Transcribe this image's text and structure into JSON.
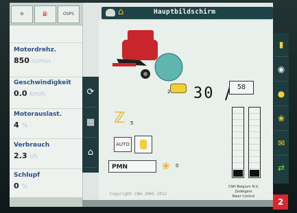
{
  "header": {
    "title": "Hauptbildschirm"
  },
  "sidebar": {
    "top_icon_caption": "OSPS",
    "metrics": [
      {
        "label": "Motordrehz.",
        "value": "850",
        "unit": "U/min"
      },
      {
        "label": "Geschwindigkeit",
        "value": "0.0",
        "unit": "km/h"
      },
      {
        "label": "Motorauslast.",
        "value": "4",
        "unit": "%"
      },
      {
        "label": "Verbrauch",
        "value": "2.3",
        "unit": "l/h"
      },
      {
        "label": "Schlupf",
        "value": "0",
        "unit": "%"
      }
    ]
  },
  "main": {
    "bale_count": "30",
    "bale_target": "58",
    "knife_count": "5",
    "auto_label": "AUTO",
    "material_field": "PMN",
    "net_count": "0",
    "bale_marker": "2",
    "copyright": "Copyright CNH 2005-2012",
    "company_line1": "CNH Belgium N.V.",
    "company_line2": "Zedelgem",
    "company_line3": "Baler Control"
  },
  "bars": {
    "left_fill": 0.1,
    "right_fill": 0.1
  },
  "badge": {
    "number": "2"
  },
  "colors": {
    "accent": "#1e4346",
    "label_blue": "#2a4f8a",
    "badge_red": "#d8272e",
    "machine_red": "#c8262c",
    "bale_teal": "#5fb6b0"
  }
}
